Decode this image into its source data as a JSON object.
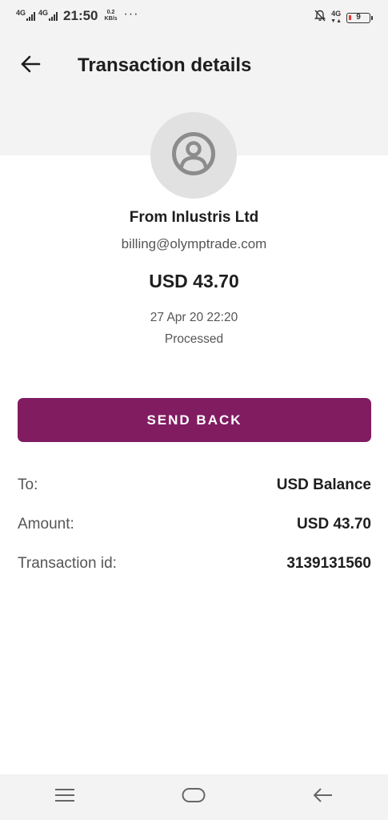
{
  "status_bar": {
    "net1_label": "4G",
    "net2_label": "4G",
    "time": "21:50",
    "speed_value": "0.2",
    "speed_unit": "KB/s",
    "more": "···",
    "right_net_label": "4G",
    "battery_level": "9",
    "battery_color": "#e53935",
    "icons": [
      "signal-icon",
      "signal-icon",
      "mute-notification-icon",
      "battery-icon"
    ]
  },
  "header": {
    "title": "Transaction details",
    "back_icon": "arrow-left-icon"
  },
  "sender": {
    "avatar_icon": "user-circle-icon",
    "name": "From Inlustris Ltd",
    "email": "billing@olymptrade.com",
    "amount": "USD 43.70",
    "date": "27 Apr 20 22:20",
    "status": "Processed"
  },
  "actions": {
    "send_back_label": "SEND BACK",
    "accent_color": "#811c61"
  },
  "details": [
    {
      "label": "To:",
      "value": "USD Balance"
    },
    {
      "label": "Amount:",
      "value": "USD 43.70"
    },
    {
      "label": "Transaction id:",
      "value": "3139131560"
    }
  ],
  "nav_bar": {
    "icons": [
      "menu-icon",
      "home-icon",
      "back-icon"
    ]
  }
}
